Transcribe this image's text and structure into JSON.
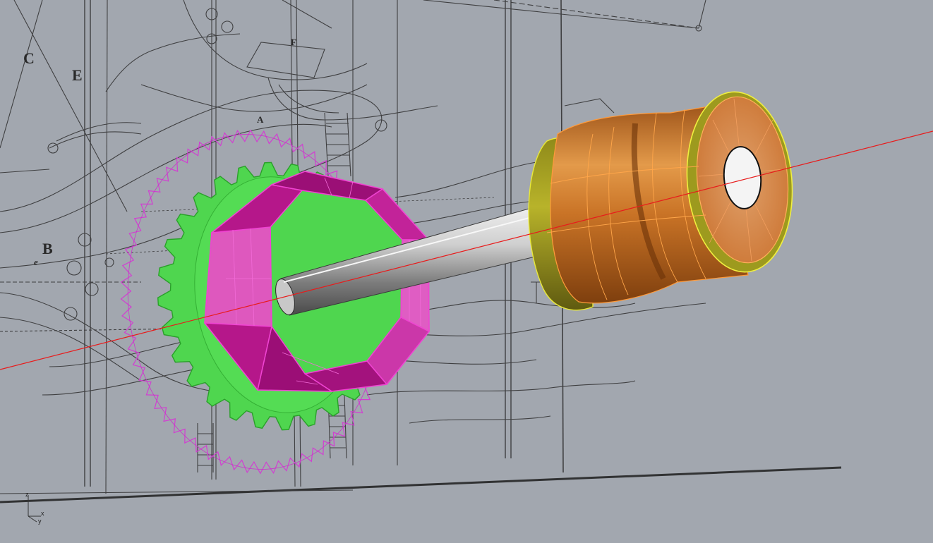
{
  "blueprint": {
    "labels": {
      "c": "C",
      "e": "E",
      "f": "F",
      "a": "A",
      "b": "B",
      "e_small": "e"
    }
  },
  "axis_widget": {
    "z": "z",
    "x": "x",
    "y": "y"
  },
  "colors": {
    "background": "#a2a7af",
    "gear_green": "#4fd84f",
    "gear_green_edge": "#2ea82e",
    "octagon_magenta": "#c2169a",
    "octagon_face": "#dd55bd",
    "bevel_gear_outline": "#d040d0",
    "spool_orange": "#d9822b",
    "spool_face": "#d8894a",
    "spool_yellow_edge": "#e8e83a",
    "shaft_gray": "#9a9a9a",
    "axis_red": "#e81b1b",
    "blueprint_ink": "#2c2c2c"
  }
}
